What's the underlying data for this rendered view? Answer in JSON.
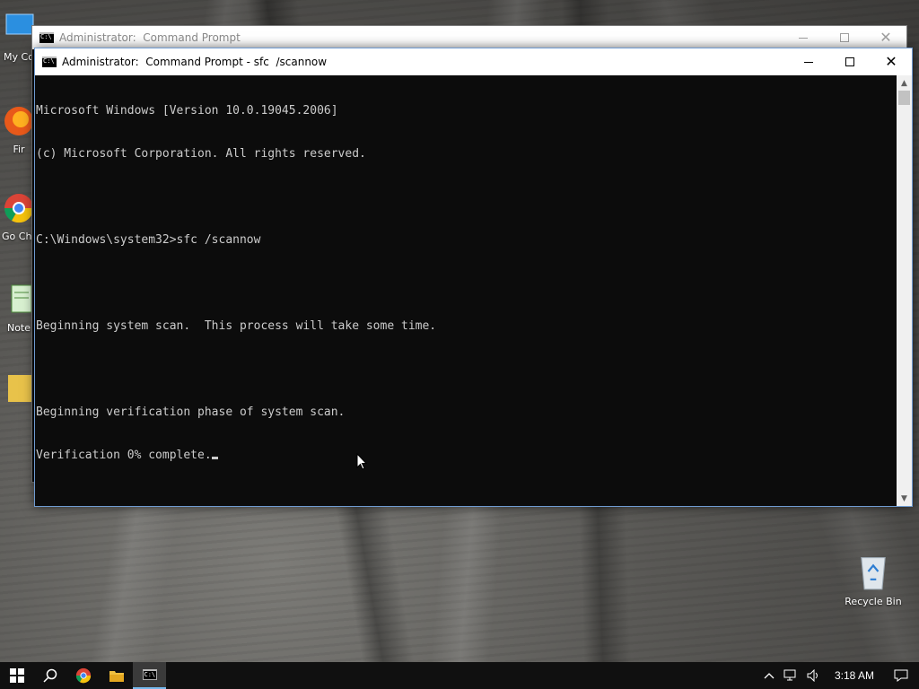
{
  "desktop": {
    "icons": [
      {
        "label": "My Co"
      },
      {
        "label": "Fir"
      },
      {
        "label": "Go Chr"
      },
      {
        "label": "Note"
      },
      {
        "label": ""
      }
    ],
    "recycle_bin": {
      "label": "Recycle Bin",
      "icon": "recycle-bin-icon"
    }
  },
  "window_back": {
    "title": "Administrator:  Command Prompt"
  },
  "window_front": {
    "title": "Administrator:  Command Prompt - sfc  /scannow",
    "console_lines": [
      "Microsoft Windows [Version 10.0.19045.2006]",
      "(c) Microsoft Corporation. All rights reserved.",
      "",
      "C:\\Windows\\system32>sfc /scannow",
      "",
      "Beginning system scan.  This process will take some time.",
      "",
      "Beginning verification phase of system scan.",
      "Verification 0% complete."
    ],
    "colors": {
      "background": "#0c0c0c",
      "text": "#cccccc",
      "border": "#6f9bd1"
    }
  },
  "taskbar": {
    "items": [
      {
        "icon": "windows-start-icon"
      },
      {
        "icon": "search-icon"
      },
      {
        "icon": "chrome-icon"
      },
      {
        "icon": "file-explorer-icon"
      },
      {
        "icon": "command-prompt-icon",
        "active": true
      }
    ],
    "tray": {
      "icons": [
        "chevron-up-icon",
        "network-icon",
        "volume-icon",
        "notifications-icon"
      ],
      "clock": "3:18 AM"
    }
  }
}
